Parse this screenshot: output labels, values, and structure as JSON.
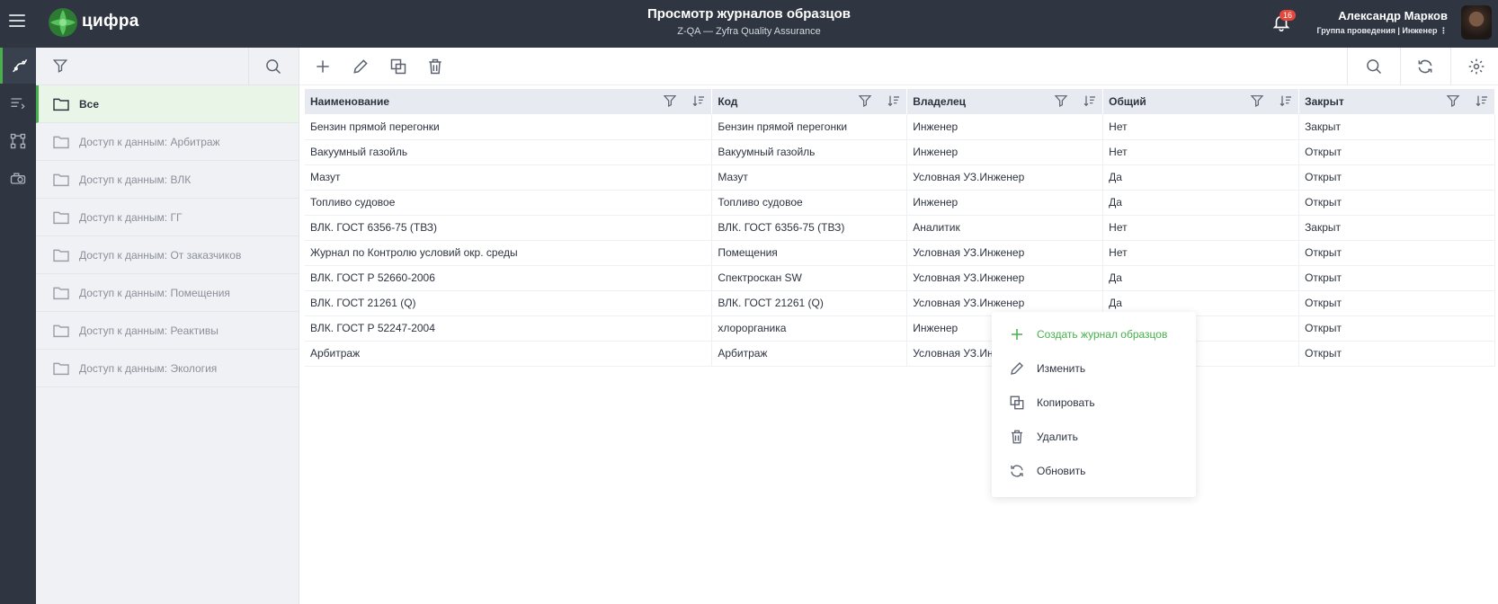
{
  "app": {
    "logo_text": "цифра"
  },
  "header": {
    "title": "Просмотр журналов образцов",
    "subtitle": "Z-QA — Zyfra Quality Assurance",
    "notifications_count": "16",
    "user_name": "Александр Марков",
    "user_role": "Группа проведения | Инженер ⋮"
  },
  "sidebar": {
    "items": [
      {
        "label": "Все"
      },
      {
        "label": "Доступ к данным: Арбитраж"
      },
      {
        "label": "Доступ к данным: ВЛК"
      },
      {
        "label": "Доступ к данным: ГГ"
      },
      {
        "label": "Доступ к данным: От заказчиков"
      },
      {
        "label": "Доступ к данным: Помещения"
      },
      {
        "label": "Доступ к данным: Реактивы"
      },
      {
        "label": "Доступ к данным: Экология"
      }
    ]
  },
  "table": {
    "columns": [
      "Наименование",
      "Код",
      "Владелец",
      "Общий",
      "Закрыт"
    ],
    "rows": [
      [
        "Бензин прямой перегонки",
        "Бензин прямой перегонки",
        "Инженер",
        "Нет",
        "Закрыт"
      ],
      [
        "Вакуумный газойль",
        "Вакуумный газойль",
        "Инженер",
        "Нет",
        "Открыт"
      ],
      [
        "Мазут",
        "Мазут",
        "Условная УЗ.Инженер",
        "Да",
        "Открыт"
      ],
      [
        "Топливо судовое",
        "Топливо судовое",
        "Инженер",
        "Да",
        "Открыт"
      ],
      [
        "ВЛК. ГОСТ 6356-75 (ТВЗ)",
        "ВЛК. ГОСТ 6356-75 (ТВЗ)",
        "Аналитик",
        "Нет",
        "Закрыт"
      ],
      [
        "Журнал по Контролю условий окр. среды",
        "Помещения",
        "Условная УЗ.Инженер",
        "Нет",
        "Открыт"
      ],
      [
        "ВЛК. ГОСТ Р 52660-2006",
        "Спектроскан SW",
        "Условная УЗ.Инженер",
        "Да",
        "Открыт"
      ],
      [
        "ВЛК. ГОСТ 21261 (Q)",
        "ВЛК. ГОСТ 21261 (Q)",
        "Условная УЗ.Инженер",
        "Да",
        "Открыт"
      ],
      [
        "ВЛК. ГОСТ Р 52247-2004",
        "хлорорганика",
        "Инженер",
        "",
        "Открыт"
      ],
      [
        "Арбитраж",
        "Арбитраж",
        "Условная УЗ.Ин",
        "",
        "Открыт"
      ]
    ]
  },
  "context_menu": {
    "create": "Создать журнал образцов",
    "edit": "Изменить",
    "copy": "Копировать",
    "delete": "Удалить",
    "refresh": "Обновить"
  },
  "colors": {
    "accent": "#47b04b",
    "topbar": "#2f3541",
    "badge": "#e5483a"
  }
}
